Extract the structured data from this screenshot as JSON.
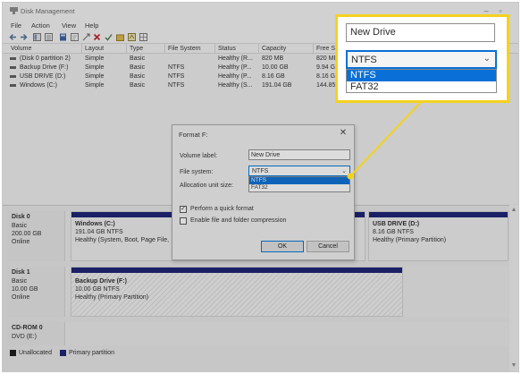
{
  "window": {
    "title": "Disk Management",
    "menu": [
      "File",
      "Action",
      "View",
      "Help"
    ]
  },
  "volume_list": {
    "columns": [
      "Volume",
      "Layout",
      "Type",
      "File System",
      "Status",
      "Capacity",
      "Free Sp"
    ],
    "rows": [
      [
        "(Disk 0 partition 2)",
        "Simple",
        "Basic",
        "",
        "Healthy (R...",
        "820 MB",
        "820 MB"
      ],
      [
        "Backup Drive (F:)",
        "Simple",
        "Basic",
        "NTFS",
        "Healthy (P...",
        "10.00 GB",
        "9.94 GB"
      ],
      [
        "USB DRIVE (D:)",
        "Simple",
        "Basic",
        "NTFS",
        "Healthy (P...",
        "8.16 GB",
        "8.16 GB"
      ],
      [
        "Windows (C:)",
        "Simple",
        "Basic",
        "NTFS",
        "Healthy (S...",
        "191.04 GB",
        "144.85 GB"
      ]
    ]
  },
  "disks": [
    {
      "name": "Disk 0",
      "type": "Basic",
      "size": "200.00 GB",
      "state": "Online",
      "partitions": [
        {
          "name": "Windows (C:)",
          "size": "191.04 GB NTFS",
          "status": "Healthy (System, Boot, Page File,"
        },
        {
          "name": "USB DRIVE (D:)",
          "size": "8.16 GB NTFS",
          "status": "Healthy (Primary Partition)"
        }
      ]
    },
    {
      "name": "Disk 1",
      "type": "Basic",
      "size": "10.00 GB",
      "state": "Online",
      "partitions": [
        {
          "name": "Backup Drive (F:)",
          "size": "10.00 GB NTFS",
          "status": "Healthy (Primary Partition)"
        }
      ]
    },
    {
      "name": "CD-ROM 0",
      "type": "DVD (E:)"
    }
  ],
  "legend": {
    "unallocated": "Unallocated",
    "primary": "Primary partition",
    "unallocated_color": "#1a1a1a",
    "primary_color": "#1a1f73"
  },
  "dialog": {
    "title": "Format F:",
    "volume_label_label": "Volume label:",
    "volume_label_value": "New Drive",
    "file_system_label": "File system:",
    "file_system_value": "NTFS",
    "file_system_options": [
      "NTFS",
      "FAT32"
    ],
    "allocation_label": "Allocation unit size:",
    "quick_format_label": "Perform a quick format",
    "quick_format_checked": true,
    "compression_label": "Enable file and folder compression",
    "compression_checked": false,
    "ok_label": "OK",
    "cancel_label": "Cancel"
  },
  "callout": {
    "volume_label_value": "New Drive",
    "file_system_value": "NTFS",
    "options": [
      "NTFS",
      "FAT32"
    ],
    "highlight_color": "#f4d21f"
  }
}
